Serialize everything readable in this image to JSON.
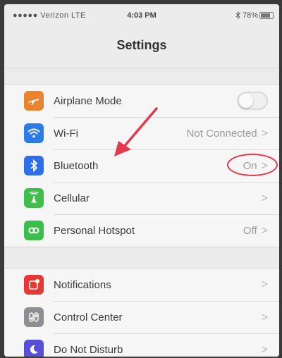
{
  "status": {
    "carrier": "●●●●● Verizon  LTE",
    "time": "4:03 PM",
    "battery_pct": "78%"
  },
  "navbar": {
    "title": "Settings"
  },
  "groups": [
    {
      "items": [
        {
          "label": "Airplane Mode",
          "icon": "airplane-icon",
          "color": "#e8832e",
          "control": "toggle",
          "toggle_state": "off"
        },
        {
          "label": "Wi-Fi",
          "icon": "wifi-icon",
          "color": "#2d7be8",
          "value": "Not Connected"
        },
        {
          "label": "Bluetooth",
          "icon": "bluetooth-icon",
          "color": "#2d6fe6",
          "value": "On"
        },
        {
          "label": "Cellular",
          "icon": "cellular-icon",
          "color": "#3fbf4a"
        },
        {
          "label": "Personal Hotspot",
          "icon": "hotspot-icon",
          "color": "#3cbf4a",
          "value": "Off"
        }
      ]
    },
    {
      "items": [
        {
          "label": "Notifications",
          "icon": "notifications-icon",
          "color": "#e53935"
        },
        {
          "label": "Control Center",
          "icon": "control-center-icon",
          "color": "#8e8e93"
        },
        {
          "label": "Do Not Disturb",
          "icon": "moon-icon",
          "color": "#5750d6"
        }
      ]
    }
  ],
  "annotation": {
    "color": "#e33a50"
  }
}
